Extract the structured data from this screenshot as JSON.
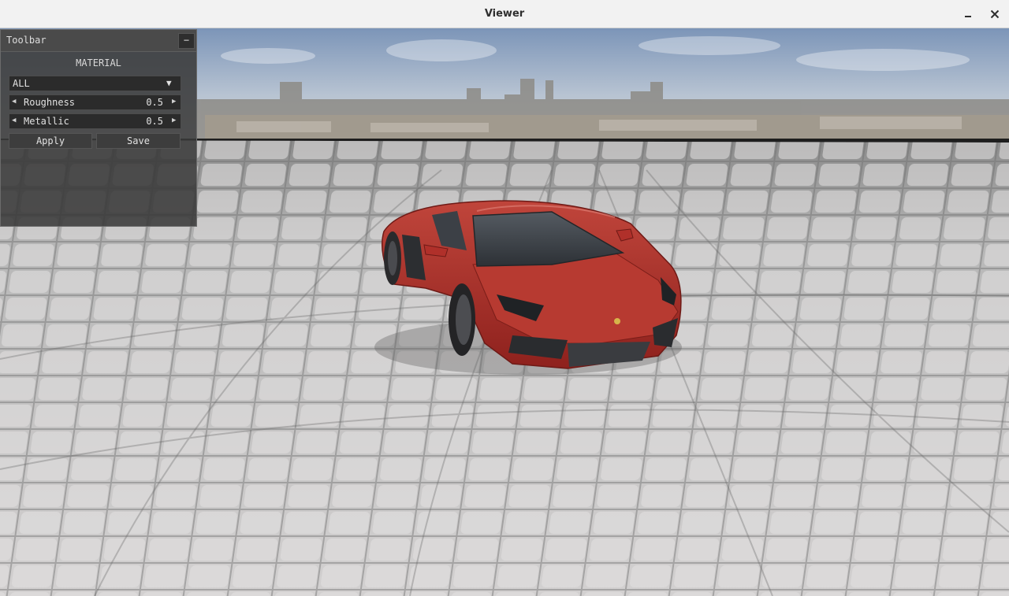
{
  "window": {
    "title": "Viewer",
    "minimize_icon": "minimize-icon",
    "close_icon": "close-icon",
    "close_glyph": "✕"
  },
  "toolbar": {
    "title": "Toolbar",
    "collapse_glyph": "−",
    "section_label": "MATERIAL",
    "material_select": {
      "value": "ALL",
      "arrow_glyph": "▼"
    },
    "sliders": [
      {
        "label": "Roughness",
        "value": "0.5",
        "left_glyph": "◀",
        "right_glyph": "▶"
      },
      {
        "label": "Metallic",
        "value": "0.5",
        "left_glyph": "◀",
        "right_glyph": "▶"
      }
    ],
    "apply_label": "Apply",
    "save_label": "Save"
  },
  "scene": {
    "sky_top": "#7c95b8",
    "sky_bottom": "#c9d3df",
    "ground_color": "#c9c9c9",
    "car_color": "#b0302a"
  }
}
